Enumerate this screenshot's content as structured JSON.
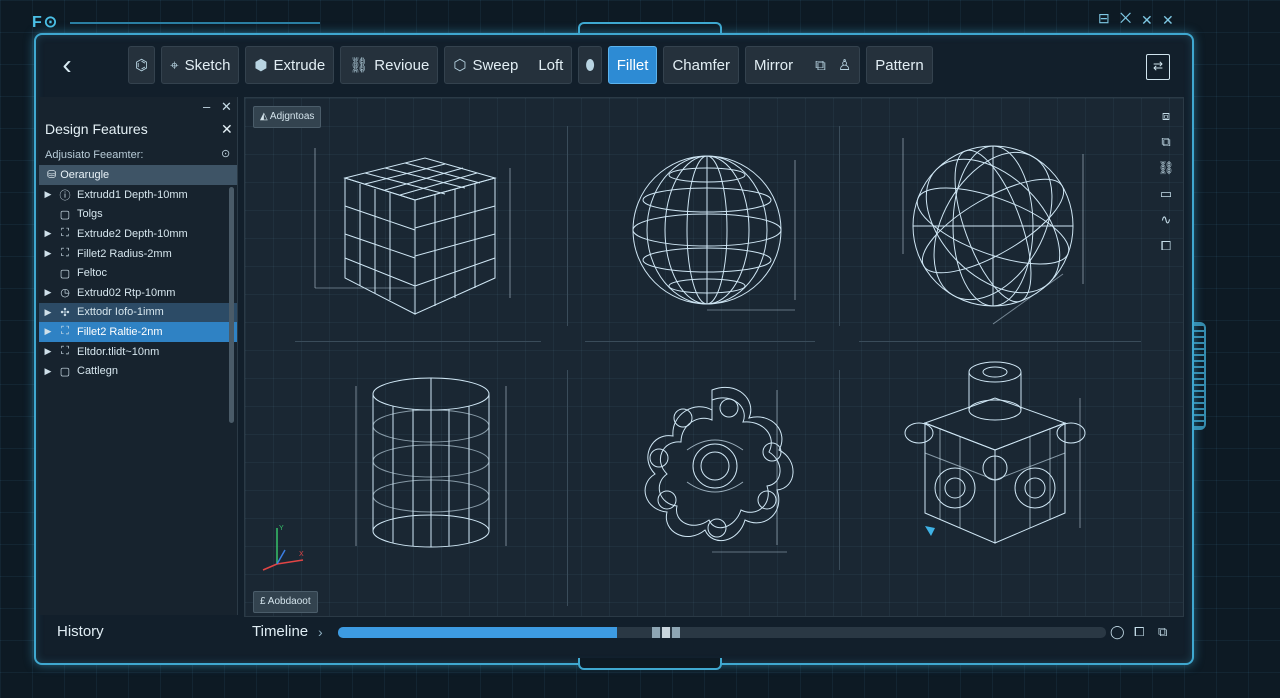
{
  "window": {
    "logo": "F⊙",
    "controls": [
      "⊟",
      "⨉",
      "✕"
    ]
  },
  "toolbar": {
    "back_icon": "chevron-left-icon",
    "tools": [
      {
        "label": "",
        "icon": "sketch-nodes-icon"
      },
      {
        "label": "Sketch",
        "icon": "sketch-icon"
      },
      {
        "label": "Extrude",
        "icon": "extrude-icon"
      },
      {
        "label": "Revioue",
        "icon": "revolve-icon"
      },
      {
        "label": "Sweep",
        "icon": "sweep-icon"
      },
      {
        "label": "Loft",
        "icon": ""
      },
      {
        "label": "",
        "icon": "loft-icon"
      },
      {
        "label": "Fillet",
        "icon": "",
        "active": true
      },
      {
        "label": "Chamfer",
        "icon": ""
      },
      {
        "label": "Mirror",
        "icon": ""
      },
      {
        "label": "",
        "icon": "mirror-icon"
      },
      {
        "label": "",
        "icon": "user-icon"
      },
      {
        "label": "Pattern",
        "icon": ""
      }
    ]
  },
  "sidebar": {
    "title": "Design Features",
    "subtitle": "Adjusiato Feeamter:",
    "header": "Oerarugle",
    "items": [
      {
        "label": "Extrudd1 Depth-10mm",
        "caret": true,
        "state": ""
      },
      {
        "label": "Tolgs",
        "caret": false,
        "state": ""
      },
      {
        "label": "Extrude2 Depth-10mm",
        "caret": true,
        "state": ""
      },
      {
        "label": "Fillet2 Radius-2mm",
        "caret": true,
        "state": ""
      },
      {
        "label": "Feltoc",
        "caret": false,
        "state": ""
      },
      {
        "label": "Extrud02 Rtp-10mm",
        "caret": true,
        "state": ""
      },
      {
        "label": "Exttodr Iofo-1imm",
        "caret": true,
        "state": "hl"
      },
      {
        "label": "Fillet2 Raltie-2nm",
        "caret": true,
        "state": "sel"
      },
      {
        "label": "Eltdor.tlidt~10nm",
        "caret": true,
        "state": ""
      },
      {
        "label": "Cattlegn",
        "caret": true,
        "state": ""
      }
    ]
  },
  "viewport": {
    "top_label": "Adjgntoas",
    "bottom_label": "Aobdaoot",
    "axes": {
      "y": "Y",
      "x": "X"
    }
  },
  "bottom": {
    "history": "History",
    "timeline": "Timeline",
    "progress": 0.363
  },
  "colors": {
    "accent": "#3fa8d0",
    "active": "#2d8bd4",
    "wire": "#cfe6f4"
  }
}
